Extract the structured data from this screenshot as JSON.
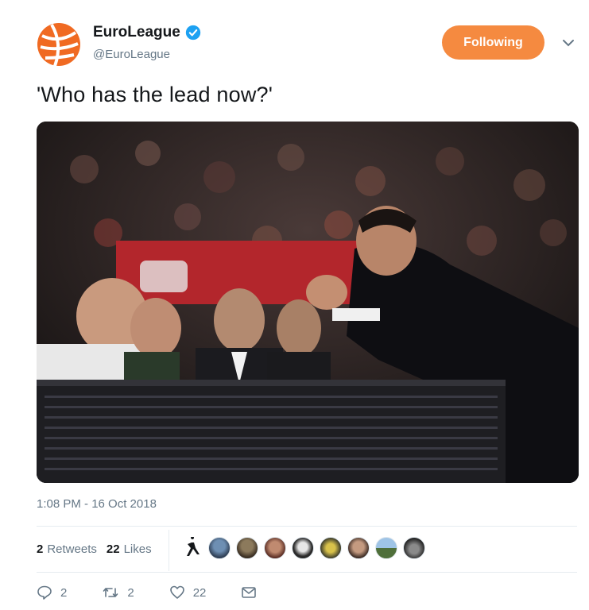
{
  "account": {
    "display_name": "EuroLeague",
    "handle": "@EuroLeague",
    "avatar_icon": "euroleague-logo-icon",
    "verified_icon": "verified-badge-icon"
  },
  "follow_button": {
    "label": "Following"
  },
  "tweet": {
    "text": "'Who has the lead now?'",
    "timestamp": "1:08 PM - 16 Oct 2018"
  },
  "stats": {
    "retweets_count": "2",
    "retweets_label": "Retweets",
    "likes_count": "22",
    "likes_label": "Likes"
  },
  "actions": {
    "reply_count": "2",
    "retweet_count": "2",
    "like_count": "22"
  },
  "colors": {
    "brand_orange": "#f58a40",
    "text_secondary": "#657786",
    "verified_blue": "#1da1f2"
  }
}
